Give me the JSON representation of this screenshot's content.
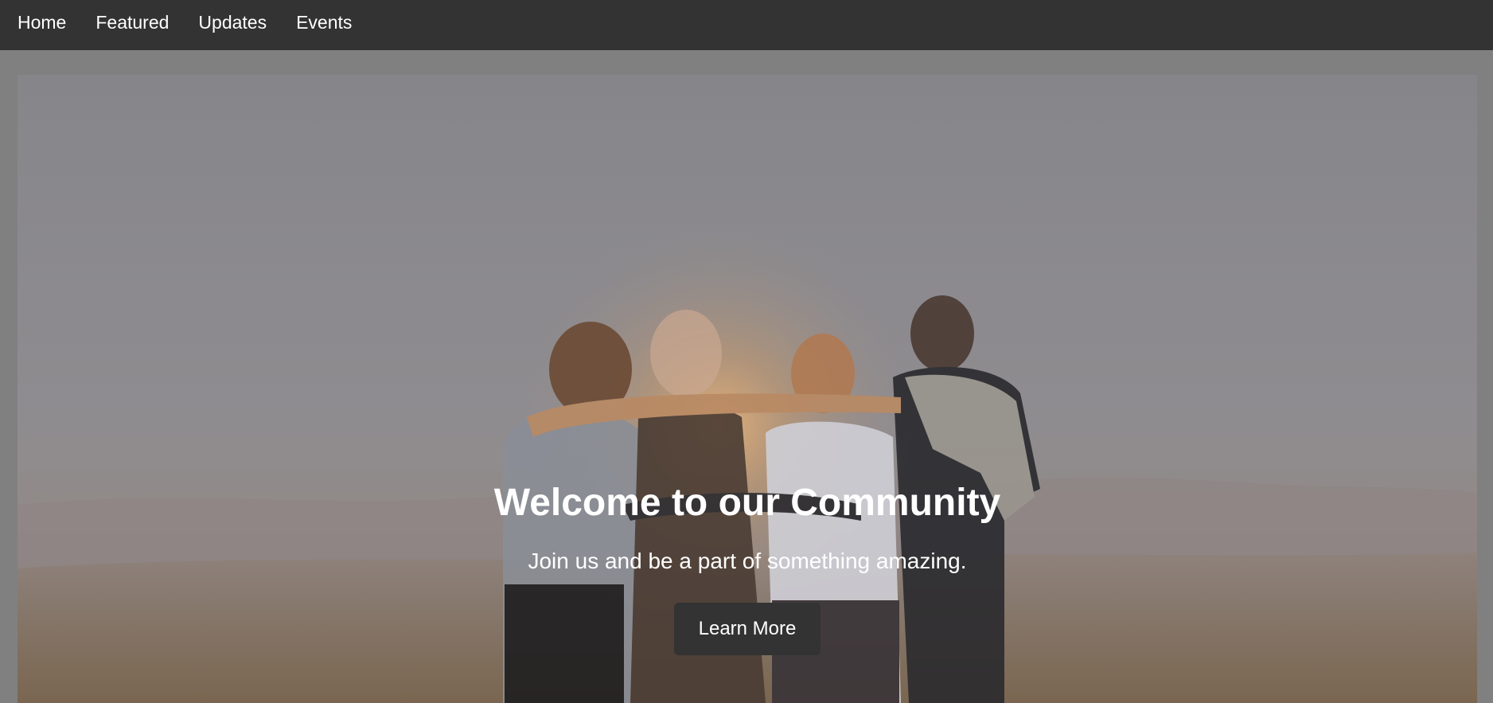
{
  "nav": {
    "items": [
      {
        "label": "Home"
      },
      {
        "label": "Featured"
      },
      {
        "label": "Updates"
      },
      {
        "label": "Events"
      }
    ]
  },
  "hero": {
    "title": "Welcome to our Community",
    "subtitle": "Join us and be a part of something amazing.",
    "button_label": "Learn More",
    "image": "photo of four friends embracing, seen from behind, at sunset"
  },
  "colors": {
    "nav_bg": "#333333",
    "page_bg": "#808080",
    "button_bg": "#333333",
    "text": "#ffffff"
  }
}
